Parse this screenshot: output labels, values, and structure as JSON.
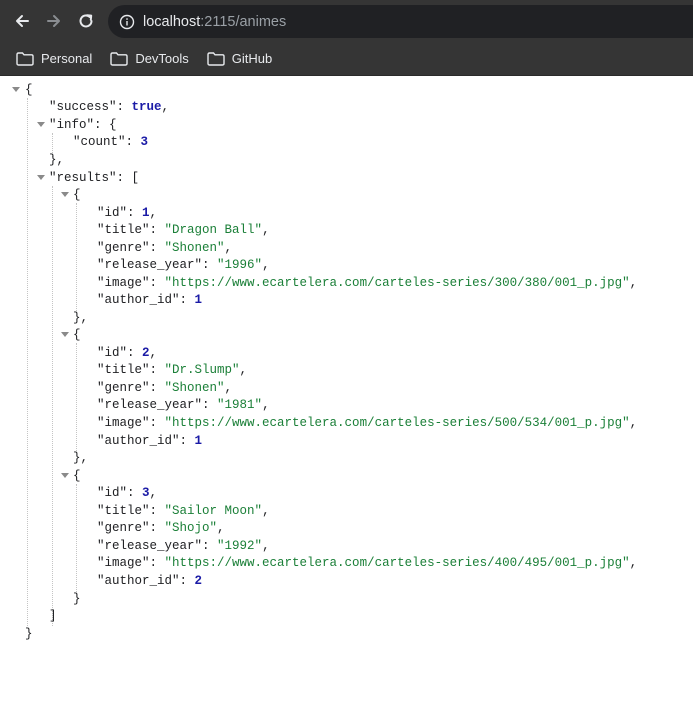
{
  "browser": {
    "url_host": "localhost",
    "url_rest": ":2115/animes",
    "bookmarks": [
      {
        "label": "Personal"
      },
      {
        "label": "DevTools"
      },
      {
        "label": "GitHub"
      }
    ]
  },
  "json": {
    "success_key": "\"success\"",
    "success_value": "true",
    "info_key": "\"info\"",
    "count_key": "\"count\"",
    "count_value": "3",
    "results_key": "\"results\"",
    "results": [
      {
        "id": "1",
        "title": "\"Dragon Ball\"",
        "genre": "\"Shonen\"",
        "release_year": "\"1996\"",
        "image": "\"https://www.ecartelera.com/carteles-series/300/380/001_p.jpg\"",
        "author_id": "1"
      },
      {
        "id": "2",
        "title": "\"Dr.Slump\"",
        "genre": "\"Shonen\"",
        "release_year": "\"1981\"",
        "image": "\"https://www.ecartelera.com/carteles-series/500/534/001_p.jpg\"",
        "author_id": "1"
      },
      {
        "id": "3",
        "title": "\"Sailor Moon\"",
        "genre": "\"Shojo\"",
        "release_year": "\"1992\"",
        "image": "\"https://www.ecartelera.com/carteles-series/400/495/001_p.jpg\"",
        "author_id": "2"
      }
    ],
    "field_keys": {
      "id": "\"id\"",
      "title": "\"title\"",
      "genre": "\"genre\"",
      "release_year": "\"release_year\"",
      "image": "\"image\"",
      "author_id": "\"author_id\""
    }
  }
}
